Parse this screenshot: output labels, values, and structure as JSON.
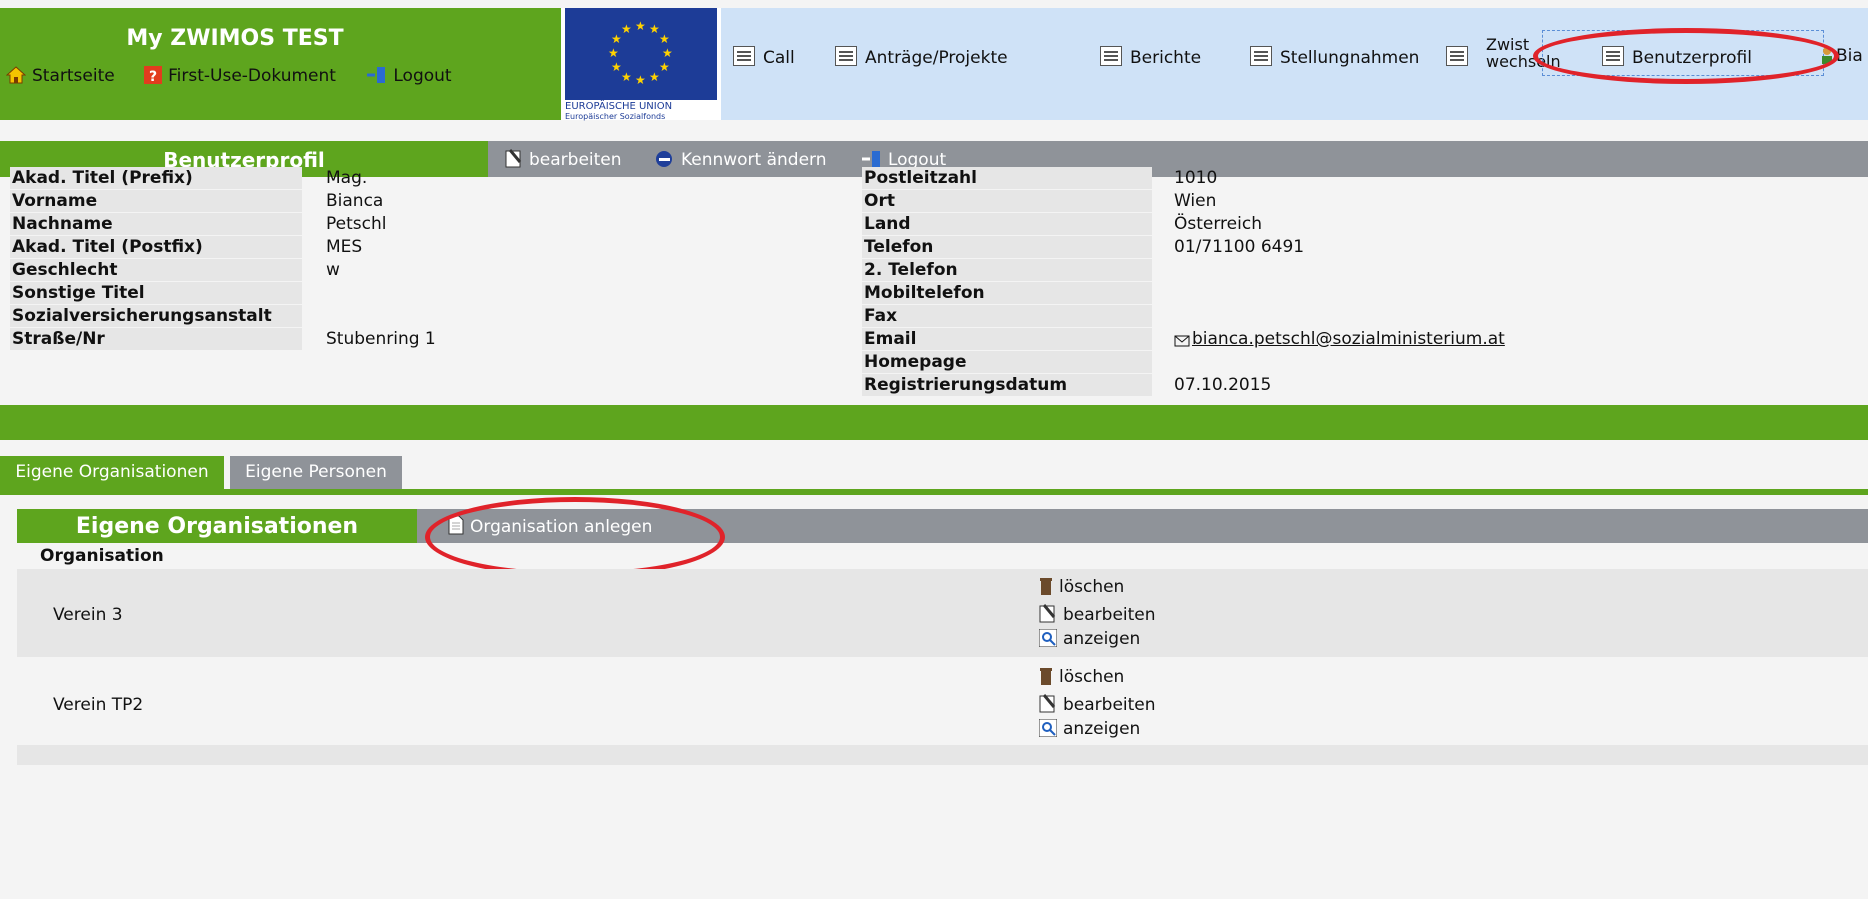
{
  "header": {
    "app_title": "My ZWIMOS TEST",
    "links": [
      {
        "label": "Startseite",
        "icon": "home-icon"
      },
      {
        "label": "First-Use-Dokument",
        "icon": "help-icon"
      },
      {
        "label": "Logout",
        "icon": "logout-icon"
      }
    ],
    "eu_logo_line1": "EUROPÄISCHE UNION",
    "eu_logo_line2": "Europäischer Sozialfonds",
    "nav": [
      {
        "label": "Call"
      },
      {
        "label": "Anträge/Projekte"
      },
      {
        "label": "Berichte"
      },
      {
        "label": "Stellungnahmen"
      },
      {
        "label": "Zwist"
      },
      {
        "label": "Benutzerprofil"
      }
    ],
    "nav_sub": "wechseln",
    "user_truncated": "Bia"
  },
  "profile_bar": {
    "title": "Benutzerprofil",
    "actions": [
      {
        "label": "bearbeiten",
        "icon": "edit-icon"
      },
      {
        "label": "Kennwort ändern",
        "icon": "key-icon"
      },
      {
        "label": "Logout",
        "icon": "logout-icon"
      }
    ]
  },
  "profile_left": [
    {
      "label": "Akad. Titel (Prefix)",
      "value": "Mag."
    },
    {
      "label": "Vorname",
      "value": "Bianca"
    },
    {
      "label": "Nachname",
      "value": "Petschl"
    },
    {
      "label": "Akad. Titel (Postfix)",
      "value": "MES"
    },
    {
      "label": "Geschlecht",
      "value": "w"
    },
    {
      "label": "Sonstige Titel",
      "value": ""
    },
    {
      "label": "Sozialversicherungsanstalt",
      "value": ""
    },
    {
      "label": "Straße/Nr",
      "value": "Stubenring 1"
    }
  ],
  "profile_right": [
    {
      "label": "Postleitzahl",
      "value": "1010"
    },
    {
      "label": "Ort",
      "value": "Wien"
    },
    {
      "label": "Land",
      "value": "Österreich"
    },
    {
      "label": "Telefon",
      "value": "01/71100 6491"
    },
    {
      "label": "2. Telefon",
      "value": ""
    },
    {
      "label": "Mobiltelefon",
      "value": ""
    },
    {
      "label": "Fax",
      "value": ""
    },
    {
      "label": "Email",
      "value": "bianca.petschl@sozialministerium.at"
    },
    {
      "label": "Homepage",
      "value": ""
    },
    {
      "label": "Registrierungsdatum",
      "value": "07.10.2015"
    }
  ],
  "tabs": [
    {
      "label": "Eigene Organisationen",
      "active": true
    },
    {
      "label": "Eigene Personen",
      "active": false
    }
  ],
  "organisations": {
    "title": "Eigene Organisationen",
    "create_label": "Organisation anlegen",
    "column_header": "Organisation",
    "rows": [
      {
        "name": "Verein 3"
      },
      {
        "name": "Verein TP2"
      }
    ],
    "row_actions": [
      "löschen",
      "bearbeiten",
      "anzeigen"
    ]
  },
  "colors": {
    "green": "#5ea51e",
    "gray": "#8f9399",
    "nav_bg": "#cfe2f7",
    "highlight": "#e0232a"
  }
}
